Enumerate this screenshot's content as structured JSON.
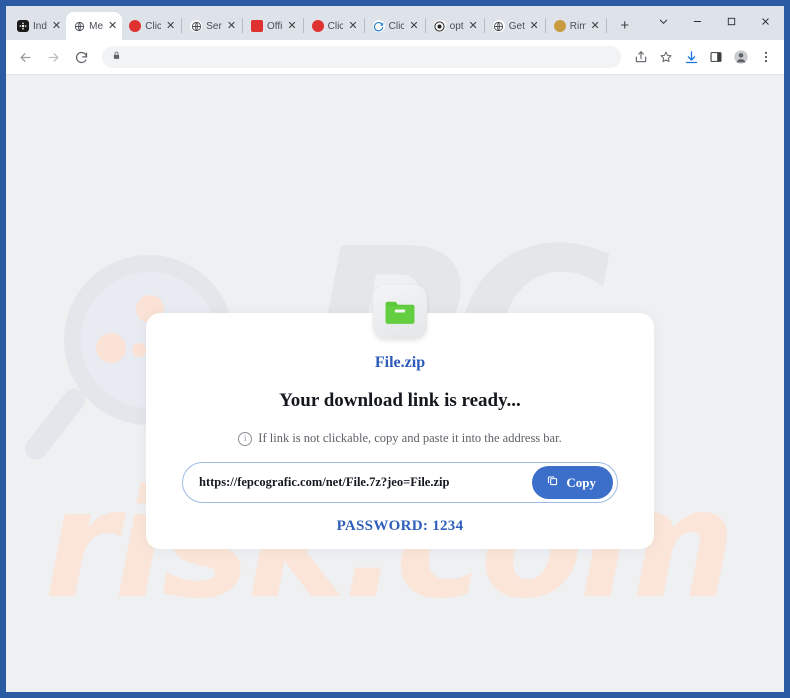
{
  "window": {
    "border_color": "#2a5ba3",
    "controls": [
      {
        "name": "tab-search-button",
        "glyph": "⌄"
      },
      {
        "name": "minimize-button",
        "glyph": "–"
      },
      {
        "name": "maximize-button",
        "glyph": "□"
      },
      {
        "name": "close-button",
        "glyph": "✕"
      }
    ]
  },
  "tabs": [
    {
      "title": "Ind",
      "favicon": "film-reel-icon",
      "active": false
    },
    {
      "title": "Me",
      "favicon": "globe-icon",
      "active": true
    },
    {
      "title": "Clic",
      "favicon": "red-circle-icon",
      "active": false
    },
    {
      "title": "Ser",
      "favicon": "globe-icon",
      "active": false
    },
    {
      "title": "Offi",
      "favicon": "red-square-icon",
      "active": false
    },
    {
      "title": "Clic",
      "favicon": "red-circle-icon",
      "active": false
    },
    {
      "title": "Clic",
      "favicon": "edge-icon",
      "active": false
    },
    {
      "title": "opt",
      "favicon": "target-icon",
      "active": false
    },
    {
      "title": "Get",
      "favicon": "globe-icon",
      "active": false
    },
    {
      "title": "Rim",
      "favicon": "gold-circle-icon",
      "active": false
    }
  ],
  "new_tab_label": "+",
  "toolbar": {
    "back_label": "←",
    "forward_label": "→",
    "reload_label": "⟳",
    "address": {
      "lock_icon": "lock-icon",
      "value": "",
      "placeholder": ""
    },
    "right_icons": [
      {
        "name": "share-icon"
      },
      {
        "name": "bookmark-star-icon"
      },
      {
        "name": "download-icon"
      },
      {
        "name": "side-panel-icon"
      },
      {
        "name": "profile-avatar-icon"
      },
      {
        "name": "more-menu-icon"
      }
    ]
  },
  "watermark": {
    "logo_text": "PC",
    "domain_text": "risk.com",
    "logo_color": "#e4e6e9",
    "domain_color": "#fbe5d9"
  },
  "page": {
    "file_icon": "zip-folder-icon",
    "file_name": "File.zip",
    "headline": "Your download link is ready...",
    "subline": "If link is not clickable, copy and paste it into the address bar.",
    "info_icon_glyph": "i",
    "download_url": "https://fepcografic.com/net/File.7z?jeo=File.zip",
    "copy_button_label": "Copy",
    "copy_button_color": "#3c6fc9",
    "password_line": "PASSWORD: 1234",
    "password_color": "#2f5fba",
    "file_name_color": "#2d5bb9"
  }
}
